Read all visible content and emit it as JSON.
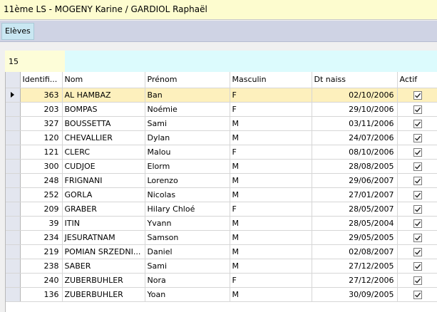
{
  "window": {
    "title": "11ème LS - MOGENY Karine / GARDIOL Raphaël"
  },
  "tabs": [
    {
      "label": "Elèves"
    }
  ],
  "count": {
    "value": "15"
  },
  "grid": {
    "columns": [
      "Identifi...",
      "Nom",
      "Prénom",
      "Masculin",
      "Dt naiss",
      "Actif"
    ],
    "rows": [
      {
        "id": "363",
        "nom": "AL HAMBAZ",
        "prenom": "Ban",
        "masculin": "F",
        "dt_naiss": "02/10/2006",
        "actif": true,
        "selected": true
      },
      {
        "id": "203",
        "nom": "BOMPAS",
        "prenom": "Noémie",
        "masculin": "F",
        "dt_naiss": "29/10/2006",
        "actif": true
      },
      {
        "id": "327",
        "nom": "BOUSSETTA",
        "prenom": "Sami",
        "masculin": "M",
        "dt_naiss": "03/11/2006",
        "actif": true
      },
      {
        "id": "120",
        "nom": "CHEVALLIER",
        "prenom": "Dylan",
        "masculin": "M",
        "dt_naiss": "24/07/2006",
        "actif": true
      },
      {
        "id": "121",
        "nom": "CLERC",
        "prenom": "Malou",
        "masculin": "F",
        "dt_naiss": "08/10/2006",
        "actif": true
      },
      {
        "id": "300",
        "nom": "CUDJOE",
        "prenom": "Elorm",
        "masculin": "M",
        "dt_naiss": "28/08/2005",
        "actif": true
      },
      {
        "id": "248",
        "nom": "FRIGNANI",
        "prenom": "Lorenzo",
        "masculin": "M",
        "dt_naiss": "29/06/2007",
        "actif": true
      },
      {
        "id": "252",
        "nom": "GORLA",
        "prenom": "Nicolas",
        "masculin": "M",
        "dt_naiss": "27/01/2007",
        "actif": true
      },
      {
        "id": "209",
        "nom": "GRABER",
        "prenom": "Hilary Chloé",
        "masculin": "F",
        "dt_naiss": "28/05/2007",
        "actif": true
      },
      {
        "id": "39",
        "nom": "ITIN",
        "prenom": "Yvann",
        "masculin": "M",
        "dt_naiss": "28/05/2004",
        "actif": true
      },
      {
        "id": "234",
        "nom": "JESURATNAM",
        "prenom": "Samson",
        "masculin": "M",
        "dt_naiss": "29/05/2005",
        "actif": true
      },
      {
        "id": "219",
        "nom": "POMIAN SRZEDNI...",
        "prenom": "Daniel",
        "masculin": "M",
        "dt_naiss": "02/08/2007",
        "actif": true
      },
      {
        "id": "238",
        "nom": "SABER",
        "prenom": "Sami",
        "masculin": "M",
        "dt_naiss": "27/12/2005",
        "actif": true
      },
      {
        "id": "240",
        "nom": "ZUBERBUHLER",
        "prenom": "Nora",
        "masculin": "F",
        "dt_naiss": "27/12/2006",
        "actif": true
      },
      {
        "id": "136",
        "nom": "ZUBERBUHLER",
        "prenom": "Yoan",
        "masculin": "M",
        "dt_naiss": "30/09/2005",
        "actif": true
      }
    ]
  },
  "colors": {
    "title_bg": "#fdfccf",
    "tab_bg": "#c9e7f2",
    "count_bg": "#dcfbfd",
    "selected_row": "#fdf0bd"
  }
}
